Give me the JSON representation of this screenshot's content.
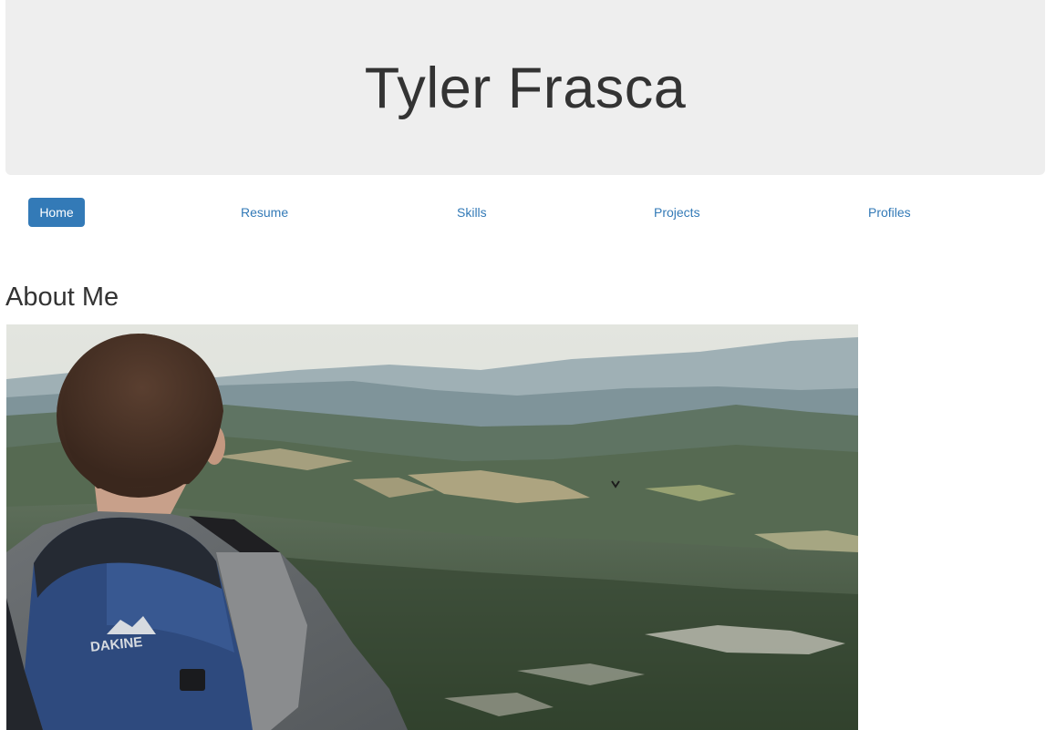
{
  "header": {
    "title": "Tyler Frasca"
  },
  "nav": {
    "items": [
      {
        "label": "Home",
        "active": true
      },
      {
        "label": "Resume",
        "active": false
      },
      {
        "label": "Skills",
        "active": false
      },
      {
        "label": "Projects",
        "active": false
      },
      {
        "label": "Profiles",
        "active": false
      }
    ]
  },
  "main": {
    "section_title": "About Me",
    "photo": {
      "subject": "hiker-with-backpack-overlooking-forested-valley",
      "backpack_brand": "DAKINE"
    }
  },
  "colors": {
    "jumbotron_bg": "#eeeeee",
    "accent": "#337ab7",
    "text": "#333333"
  }
}
